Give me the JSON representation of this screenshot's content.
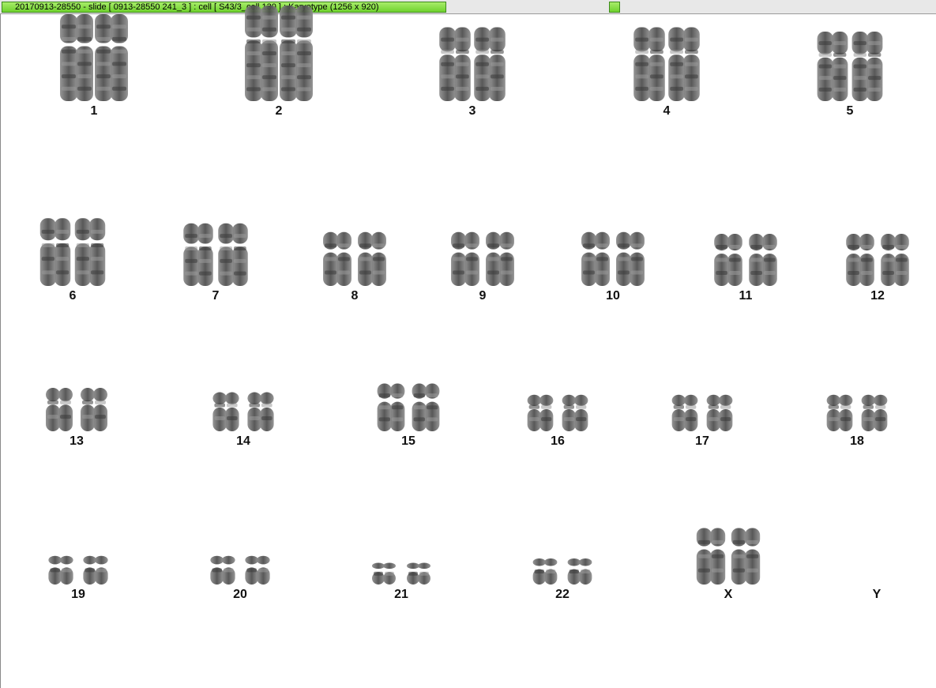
{
  "window": {
    "title": "20170913-28550 - slide [ 0913-28550 241_3 ] : cell [ S43/3_cell 130 ] : Karyotype  (1256 x 920)"
  },
  "colors": {
    "tab_green": "#7edb3a",
    "chromosome_dark": "#3a3a3a",
    "chromosome_light": "#9a9a9a"
  },
  "karyotype": {
    "rows": [
      {
        "chromosomes": [
          {
            "label": "1",
            "count": 2,
            "size": 1.0
          },
          {
            "label": "2",
            "count": 2,
            "size": 1.1
          },
          {
            "label": "3",
            "count": 2,
            "size": 0.85
          },
          {
            "label": "4",
            "count": 2,
            "size": 0.85
          },
          {
            "label": "5",
            "count": 2,
            "size": 0.8
          }
        ]
      },
      {
        "chromosomes": [
          {
            "label": "6",
            "count": 2,
            "size": 0.78
          },
          {
            "label": "7",
            "count": 2,
            "size": 0.72
          },
          {
            "label": "8",
            "count": 2,
            "size": 0.62
          },
          {
            "label": "9",
            "count": 2,
            "size": 0.62
          },
          {
            "label": "10",
            "count": 2,
            "size": 0.62
          },
          {
            "label": "11",
            "count": 2,
            "size": 0.6
          },
          {
            "label": "12",
            "count": 2,
            "size": 0.6
          }
        ]
      },
      {
        "chromosomes": [
          {
            "label": "13",
            "count": 2,
            "size": 0.5
          },
          {
            "label": "14",
            "count": 2,
            "size": 0.45
          },
          {
            "label": "15",
            "count": 2,
            "size": 0.55
          },
          {
            "label": "16",
            "count": 2,
            "size": 0.42
          },
          {
            "label": "17",
            "count": 2,
            "size": 0.42
          },
          {
            "label": "18",
            "count": 2,
            "size": 0.42
          }
        ]
      },
      {
        "chromosomes": [
          {
            "label": "19",
            "count": 2,
            "size": 0.33
          },
          {
            "label": "20",
            "count": 2,
            "size": 0.33
          },
          {
            "label": "21",
            "count": 2,
            "size": 0.25
          },
          {
            "label": "22",
            "count": 2,
            "size": 0.3
          },
          {
            "label": "X",
            "count": 2,
            "size": 0.65
          },
          {
            "label": "Y",
            "count": 0,
            "size": 0
          }
        ]
      }
    ]
  }
}
